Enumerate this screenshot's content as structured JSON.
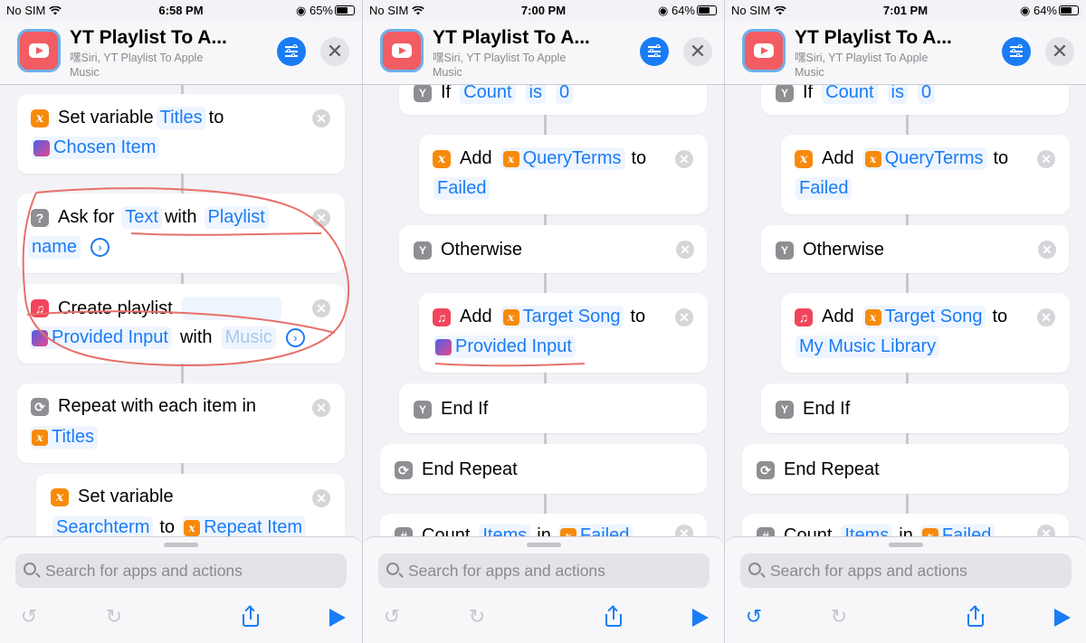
{
  "panels": [
    {
      "status": {
        "carrier": "No SIM",
        "time": "6:58 PM",
        "battery": "65%",
        "battery_level": 0.65
      },
      "header": {
        "title": "YT Playlist To A...",
        "subtitle": "嘿Siri, YT Playlist To Apple Music"
      },
      "actions": {
        "set_variable": {
          "verb": "Set variable",
          "var": "Titles",
          "to": "to",
          "value": "Chosen Item"
        },
        "ask_for": {
          "verb": "Ask for",
          "type": "Text",
          "with": "with",
          "prompt_a": "Playlist",
          "prompt_b": "name"
        },
        "create_playlist": {
          "verb": "Create playlist",
          "input": "Provided Input",
          "with": "with",
          "value": "Music"
        },
        "repeat": {
          "verb": "Repeat with each item in",
          "value": "Titles"
        },
        "set_variable2": {
          "verb": "Set variable",
          "var": "Searchterm",
          "to": "to",
          "value": "Repeat Item"
        }
      },
      "search": {
        "placeholder": "Search for apps and actions"
      }
    },
    {
      "status": {
        "carrier": "No SIM",
        "time": "7:00 PM",
        "battery": "64%",
        "battery_level": 0.64
      },
      "header": {
        "title": "YT Playlist To A...",
        "subtitle": "嘿Siri, YT Playlist To Apple Music"
      },
      "actions": {
        "if": {
          "verb": "If",
          "var": "Count",
          "is": "is",
          "value": "0"
        },
        "add_failed": {
          "verb": "Add",
          "var": "QueryTerms",
          "to": "to",
          "dest": "Failed"
        },
        "otherwise": {
          "verb": "Otherwise"
        },
        "add_target": {
          "verb": "Add",
          "var": "Target Song",
          "to": "to",
          "dest": "Provided Input"
        },
        "end_if": {
          "verb": "End If"
        },
        "end_repeat": {
          "verb": "End Repeat"
        },
        "count": {
          "verb": "Count",
          "var": "Items",
          "in": "in",
          "value": "Failed"
        }
      },
      "search": {
        "placeholder": "Search for apps and actions"
      }
    },
    {
      "status": {
        "carrier": "No SIM",
        "time": "7:01 PM",
        "battery": "64%",
        "battery_level": 0.64
      },
      "header": {
        "title": "YT Playlist To A...",
        "subtitle": "嘿Siri, YT Playlist To Apple Music"
      },
      "actions": {
        "if": {
          "verb": "If",
          "var": "Count",
          "is": "is",
          "value": "0"
        },
        "add_failed": {
          "verb": "Add",
          "var": "QueryTerms",
          "to": "to",
          "dest": "Failed"
        },
        "otherwise": {
          "verb": "Otherwise"
        },
        "add_target": {
          "verb": "Add",
          "var": "Target Song",
          "to": "to",
          "dest": "My Music Library"
        },
        "end_if": {
          "verb": "End If"
        },
        "end_repeat": {
          "verb": "End Repeat"
        },
        "count": {
          "verb": "Count",
          "var": "Items",
          "in": "in",
          "value": "Failed"
        }
      },
      "search": {
        "placeholder": "Search for apps and actions"
      }
    }
  ],
  "colors": {
    "accent": "#1a7cf5",
    "annotation": "#e8706a",
    "variable_icon": "#f78a0b",
    "music_icon": "#f2445c"
  },
  "icons": [
    "wifi-icon",
    "battery-icon",
    "app-icon",
    "settings-icon",
    "close-icon",
    "variable-icon",
    "ask-icon",
    "music-icon",
    "shortcuts-icon",
    "repeat-icon",
    "if-icon",
    "remove-icon",
    "arrow-circle-icon",
    "search-icon",
    "undo-icon",
    "redo-icon",
    "share-icon",
    "play-icon"
  ]
}
